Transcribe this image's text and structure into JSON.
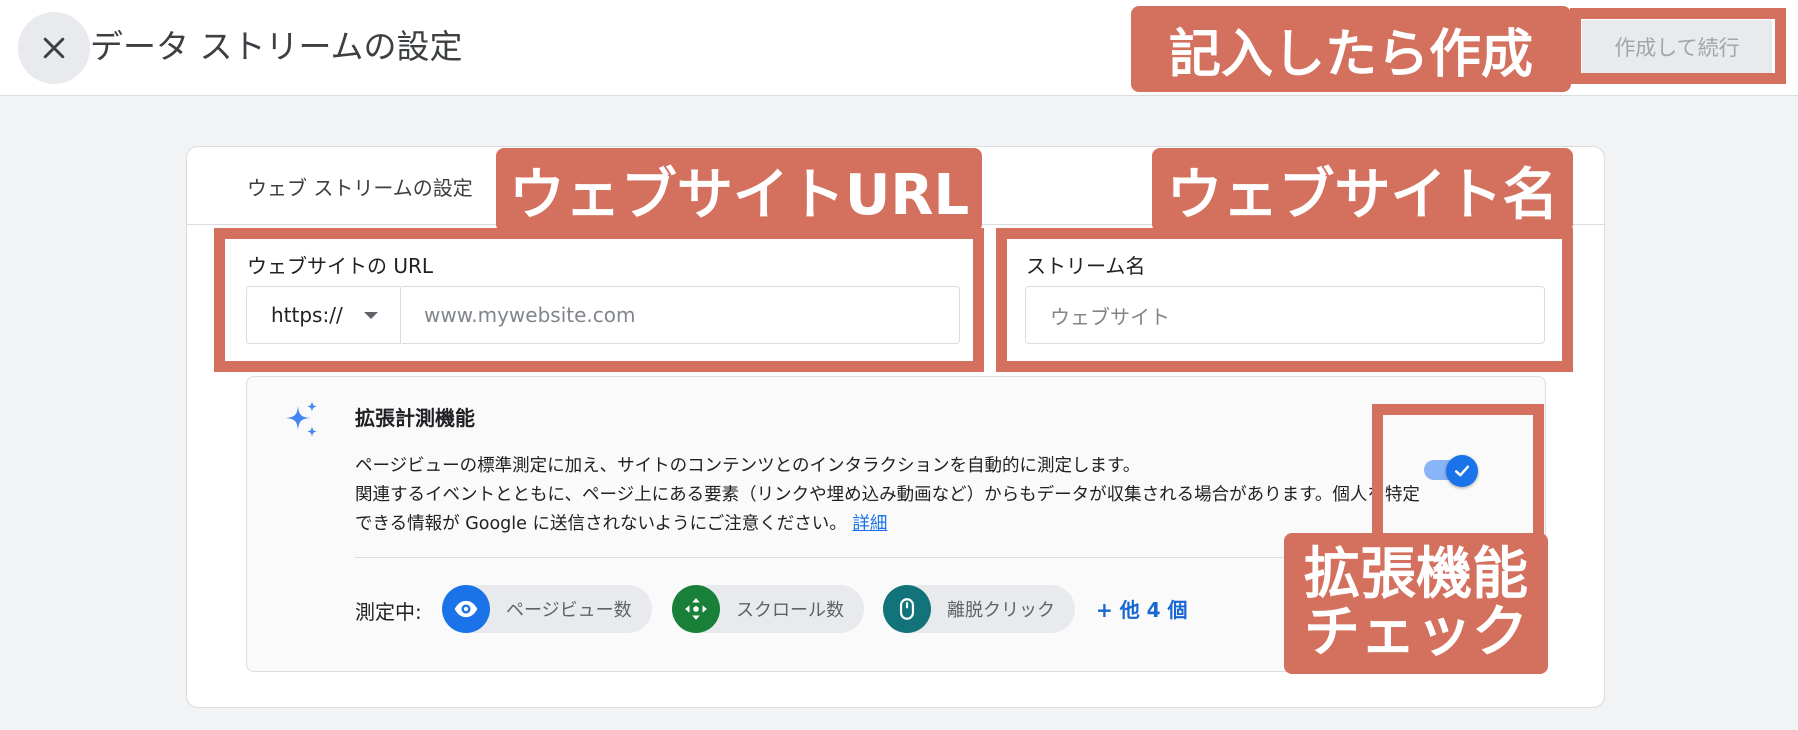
{
  "header": {
    "title": "データ ストリームの設定",
    "primary_button": "作成して続行"
  },
  "card": {
    "title": "ウェブ ストリームの設定"
  },
  "url_field": {
    "label": "ウェブサイトの URL",
    "protocol": "https://",
    "placeholder": "www.mywebsite.com"
  },
  "name_field": {
    "label": "ストリーム名",
    "placeholder": "ウェブサイト"
  },
  "enhanced": {
    "title": "拡張計測機能",
    "desc_line1": "ページビューの標準測定に加え、サイトのコンテンツとのインタラクションを自動的に測定します。",
    "desc_line2": "関連するイベントとともに、ページ上にある要素（リンクや埋め込み動画など）からもデータが収集される場合があります。個人を特定できる情報が Google に送信されないようにご注意ください。",
    "link": "詳細",
    "toggle_on": true,
    "measuring_label": "測定中:",
    "chips": [
      {
        "label": "ページビュー数",
        "icon": "eye-icon",
        "color": "#1a73e8"
      },
      {
        "label": "スクロール数",
        "icon": "scroll-arrows-icon",
        "color": "#188038"
      },
      {
        "label": "離脱クリック",
        "icon": "mouse-icon",
        "color": "#12737a"
      }
    ],
    "more": "+ 他 4 個"
  },
  "annotations": {
    "create": "記入したら作成",
    "url": "ウェブサイトURL",
    "site_name": "ウェブサイト名",
    "enhanced_line1": "拡張機能",
    "enhanced_line2": "チェック",
    "color": "#d4705e"
  }
}
